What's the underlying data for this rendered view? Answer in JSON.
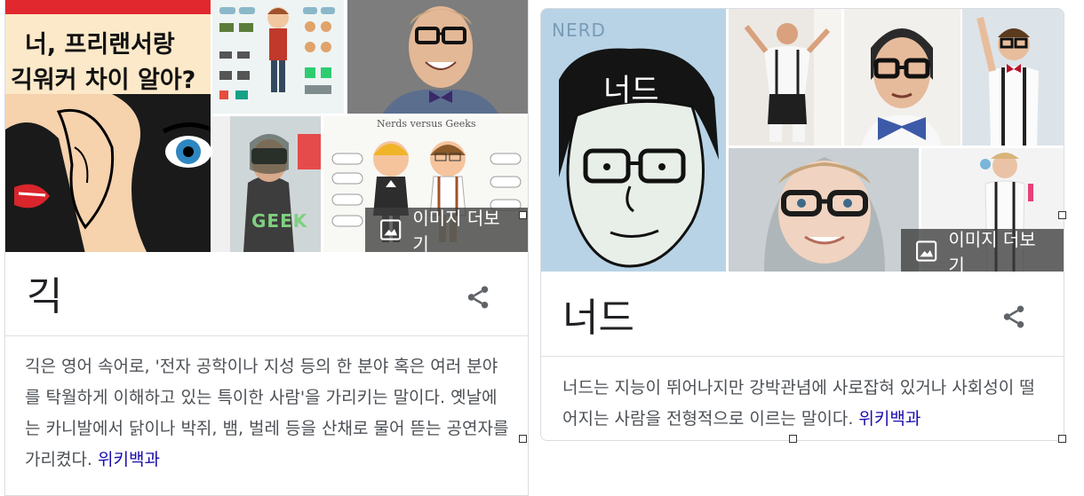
{
  "left_card": {
    "poster_text_line1": "너, 프리랜서랑",
    "poster_text_line2": "긱워커 차이 알아?",
    "geek_shirt_text": "GEEK",
    "nerds_geeks_caption": "Nerds versus Geeks",
    "more_images_label": "이미지 더보기",
    "title": "긱",
    "description": "긱은 영어 속어로, '전자 공학이나 지성 등의 한 분야 혹은 여러 분야를 탁월하게 이해하고 있는 특이한 사람'을 가리키는 말이다. 옛날에는 카니발에서 닭이나 박쥐, 뱀, 벌레 등을 산채로 물어 뜯는 공연자를 가리켰다.",
    "source_link": "위키백과"
  },
  "right_card": {
    "book_nerd_text": "NERD",
    "book_title": "너드",
    "more_images_label": "이미지 더보기",
    "title": "너드",
    "description": "너드는 지능이 뛰어나지만 강박관념에 사로잡혀 있거나 사회성이 떨어지는 사람을 전형적으로 이르는 말이다.",
    "source_link": "위키백과"
  },
  "colors": {
    "title": "#202124",
    "description": "#4d5156",
    "link": "#1a0dab",
    "poster_red": "#e0282e",
    "poster_yellow": "#fbe9c9"
  },
  "icons": [
    "image-icon",
    "share-icon"
  ]
}
